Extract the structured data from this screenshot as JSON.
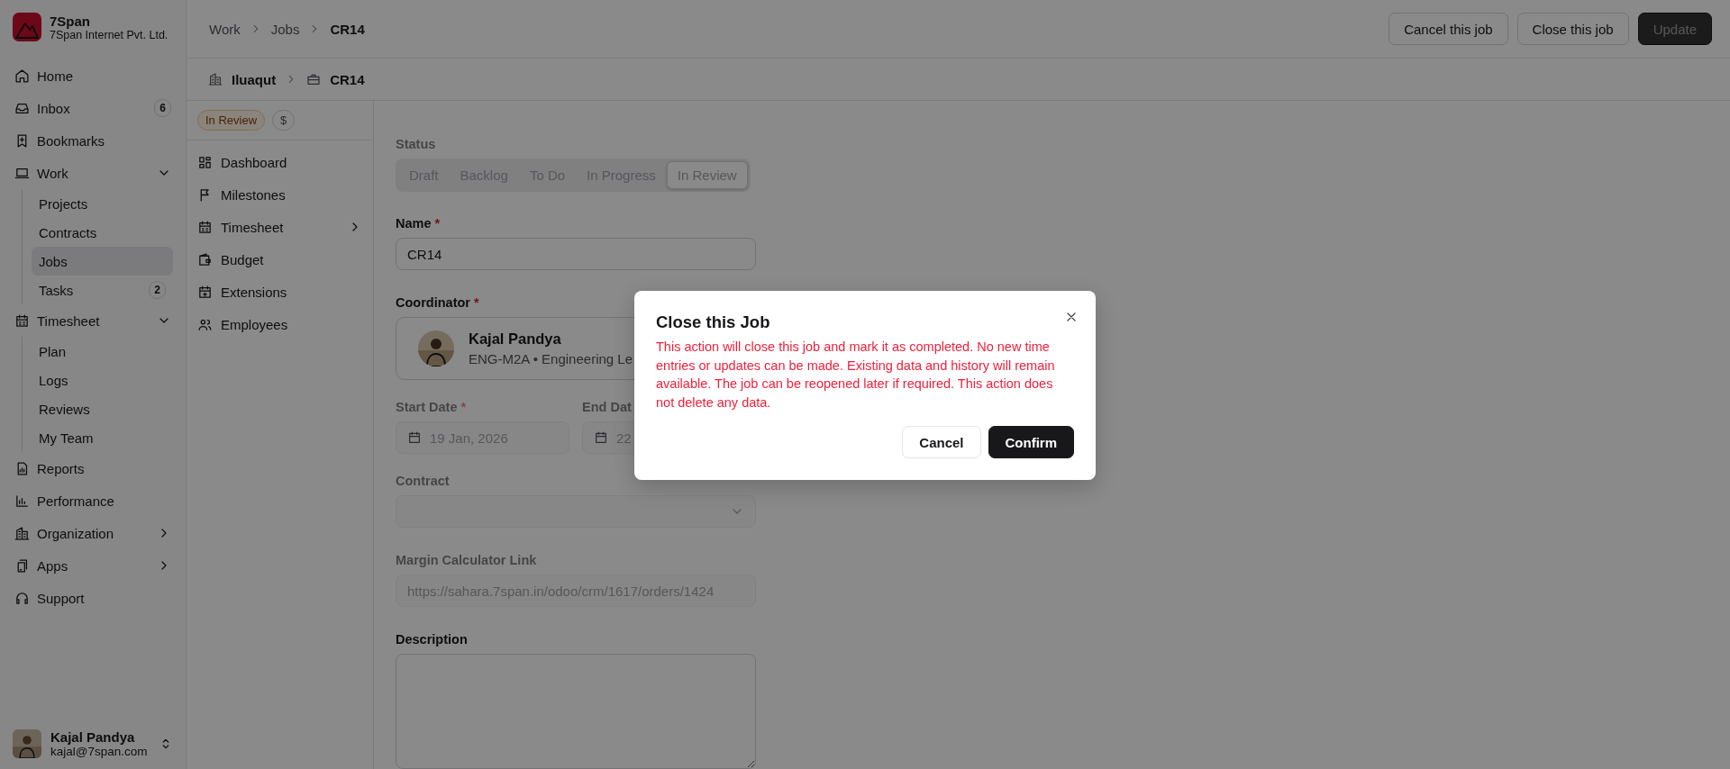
{
  "brand": {
    "name": "7Span",
    "subtitle": "7Span Internet Pvt. Ltd."
  },
  "sidebar": {
    "items": [
      {
        "label": "Home",
        "kind": "link",
        "selected": false
      },
      {
        "label": "Inbox",
        "kind": "link",
        "badge": "6",
        "selected": false
      },
      {
        "label": "Bookmarks",
        "kind": "link",
        "selected": false
      },
      {
        "label": "Work",
        "kind": "group",
        "expanded": true,
        "children": [
          {
            "label": "Projects",
            "selected": false
          },
          {
            "label": "Contracts",
            "selected": false
          },
          {
            "label": "Jobs",
            "selected": true
          },
          {
            "label": "Tasks",
            "badge": "2",
            "selected": false
          }
        ]
      },
      {
        "label": "Timesheet",
        "kind": "group",
        "expanded": true,
        "children": [
          {
            "label": "Plan",
            "selected": false
          },
          {
            "label": "Logs",
            "selected": false
          },
          {
            "label": "Reviews",
            "selected": false
          },
          {
            "label": "My Team",
            "selected": false
          }
        ]
      },
      {
        "label": "Reports",
        "kind": "link",
        "selected": false
      },
      {
        "label": "Performance",
        "kind": "link",
        "selected": false
      },
      {
        "label": "Organization",
        "kind": "group",
        "expanded": false
      },
      {
        "label": "Apps",
        "kind": "group",
        "expanded": false
      },
      {
        "label": "Support",
        "kind": "link",
        "selected": false
      }
    ]
  },
  "user": {
    "name": "Kajal Pandya",
    "email": "kajal@7span.com"
  },
  "breadcrumb": [
    "Work",
    "Jobs",
    "CR14"
  ],
  "actions": [
    {
      "label": "Cancel this job",
      "kind": "outline",
      "disabled": false
    },
    {
      "label": "Close this job",
      "kind": "outline",
      "disabled": false
    },
    {
      "label": "Update",
      "kind": "primary",
      "disabled": true
    }
  ],
  "job_path": [
    "Iluaqut",
    "CR14"
  ],
  "badges": [
    {
      "label": "In Review",
      "kind": "status"
    },
    {
      "label": "$",
      "kind": "plain"
    }
  ],
  "job_nav": [
    {
      "label": "Dashboard",
      "submenu": false
    },
    {
      "label": "Milestones",
      "submenu": false
    },
    {
      "label": "Timesheet",
      "submenu": true
    },
    {
      "label": "Budget",
      "submenu": false
    },
    {
      "label": "Extensions",
      "submenu": false
    },
    {
      "label": "Employees",
      "submenu": false
    }
  ],
  "form": {
    "status": {
      "label": "Status",
      "disabled": true,
      "options": [
        {
          "label": "Draft",
          "selected": false
        },
        {
          "label": "Backlog",
          "selected": false
        },
        {
          "label": "To Do",
          "selected": false
        },
        {
          "label": "In Progress",
          "selected": false
        },
        {
          "label": "In Review",
          "selected": true
        }
      ]
    },
    "name": {
      "label": "Name",
      "required_mark": "*",
      "value": "CR14"
    },
    "coordinator": {
      "label": "Coordinator",
      "required_mark": "*",
      "name": "Kajal Pandya",
      "detail": "ENG-M2A • Engineering Le"
    },
    "start_date": {
      "label": "Start Date",
      "required_mark": "*",
      "value": "19 Jan, 2026",
      "disabled": true
    },
    "end_date": {
      "label": "End Dat",
      "value": "22",
      "disabled": true
    },
    "contract": {
      "label": "Contract",
      "disabled": true
    },
    "margin_link": {
      "label": "Margin Calculator Link",
      "placeholder": "https://sahara.7span.in/odoo/crm/1617/orders/1424",
      "disabled": true
    },
    "description": {
      "label": "Description"
    }
  },
  "dialog": {
    "title": "Close this Job",
    "message": "This action will close this job and mark it as completed. No new time entries or updates can be made. Existing data and history will remain available. The job can be reopened later if required. This action does not delete any data.",
    "buttons": [
      {
        "label": "Cancel",
        "kind": "secondary"
      },
      {
        "label": "Confirm",
        "kind": "primary"
      }
    ]
  }
}
